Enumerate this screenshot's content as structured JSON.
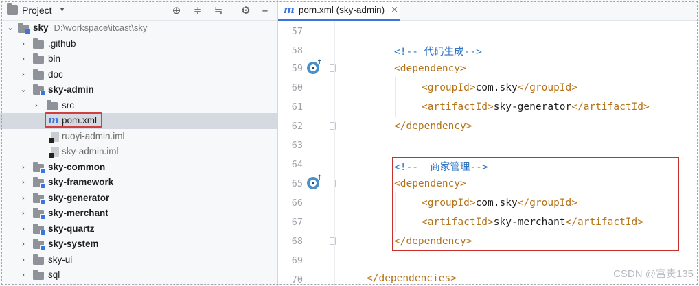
{
  "project_panel": {
    "title": "Project",
    "dropdown_icon": "chevron-down-icon",
    "header_buttons": [
      "crosshair-icon",
      "expand-all-icon",
      "collapse-all-icon",
      "gear-icon"
    ],
    "tree": [
      {
        "name": "sky",
        "hint": "D:\\workspace\\itcast\\sky",
        "expanded": true,
        "bold": true
      },
      {
        "name": ".github"
      },
      {
        "name": "bin"
      },
      {
        "name": "doc"
      },
      {
        "name": "sky-admin",
        "expanded": true,
        "bold": true
      },
      {
        "name": "src"
      },
      {
        "name": "pom.xml",
        "selected": true
      },
      {
        "name": "ruoyi-admin.iml"
      },
      {
        "name": "sky-admin.iml"
      },
      {
        "name": "sky-common",
        "bold": true
      },
      {
        "name": "sky-framework",
        "bold": true
      },
      {
        "name": "sky-generator",
        "bold": true
      },
      {
        "name": "sky-merchant",
        "bold": true
      },
      {
        "name": "sky-quartz",
        "bold": true
      },
      {
        "name": "sky-system",
        "bold": true
      },
      {
        "name": "sky-ui"
      },
      {
        "name": "sql"
      }
    ]
  },
  "editor": {
    "tab": {
      "icon": "m",
      "label": "pom.xml (sky-admin)",
      "close": "×"
    },
    "line_numbers": [
      "57",
      "58",
      "59",
      "60",
      "61",
      "62",
      "63",
      "64",
      "65",
      "66",
      "67",
      "68",
      "69",
      "70"
    ],
    "lines": {
      "l58": {
        "cmt": "<!-- 代码生成-->"
      },
      "l59": {
        "tag": "<dependency>"
      },
      "l60": {
        "open": "<groupId>",
        "text": "com.sky",
        "close": "</groupId>"
      },
      "l61": {
        "open": "<artifactId>",
        "text": "sky-generator",
        "close": "</artifactId>"
      },
      "l62": {
        "tag": "</dependency>"
      },
      "l64": {
        "cmt": "<!--  商家管理-->"
      },
      "l65": {
        "tag": "<dependency>"
      },
      "l66": {
        "open": "<groupId>",
        "text": "com.sky",
        "close": "</groupId>"
      },
      "l67": {
        "open": "<artifactId>",
        "text": "sky-merchant",
        "close": "</artifactId>"
      },
      "l68": {
        "tag": "</dependency>"
      },
      "l70": {
        "tag": "</dependencies>"
      }
    }
  },
  "watermark": "CSDN @富贵135",
  "colors": {
    "tag": "#b5731a",
    "comment": "#2f73c4",
    "highlight": "#c9302c",
    "accent": "#3b76e0"
  }
}
